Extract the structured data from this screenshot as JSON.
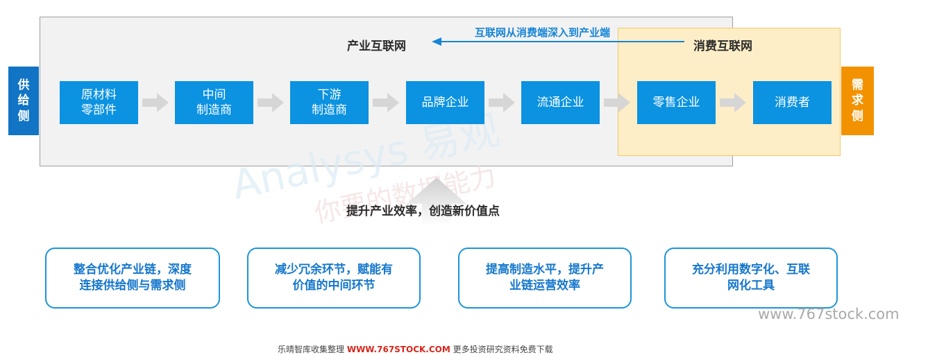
{
  "sides": {
    "supply": "供给侧",
    "demand": "需求侧"
  },
  "headers": {
    "industrial_internet": "产业互联网",
    "consumer_internet": "消费互联网",
    "shift_label": "互联网从消费端深入到产业端"
  },
  "stages": [
    "原材料\n零部件",
    "中间\n制造商",
    "下游\n制造商",
    "品牌企业",
    "流通企业",
    "零售企业",
    "消费者"
  ],
  "center_caption": "提升产业效率，创造新价值点",
  "goals": [
    "整合优化产业链，深度\n连接供给侧与需求侧",
    "减少冗余环节，赋能有\n价值的中间环节",
    "提高制造水平，提升产\n业链运营效率",
    "充分利用数字化、互联\n网化工具"
  ],
  "watermarks": {
    "url": "www.767stock.com",
    "brand": "Analysys 易观",
    "brand_cn": "你要的数据能力",
    "footer_prefix": "乐晴智库收集整理 ",
    "footer_site": "WWW.767STOCK.COM",
    "footer_suffix": " 更多投资研究资料免费下载"
  },
  "colors": {
    "stage_blue": "#0b92e0",
    "supply_blue": "#1174c4",
    "demand_orange": "#f39200",
    "frame_gray": "#f2f2f2",
    "consumer_yellow": "#fdeec7",
    "goal_border": "#1c95d7",
    "arrow_gray": "#d6d6d6"
  }
}
